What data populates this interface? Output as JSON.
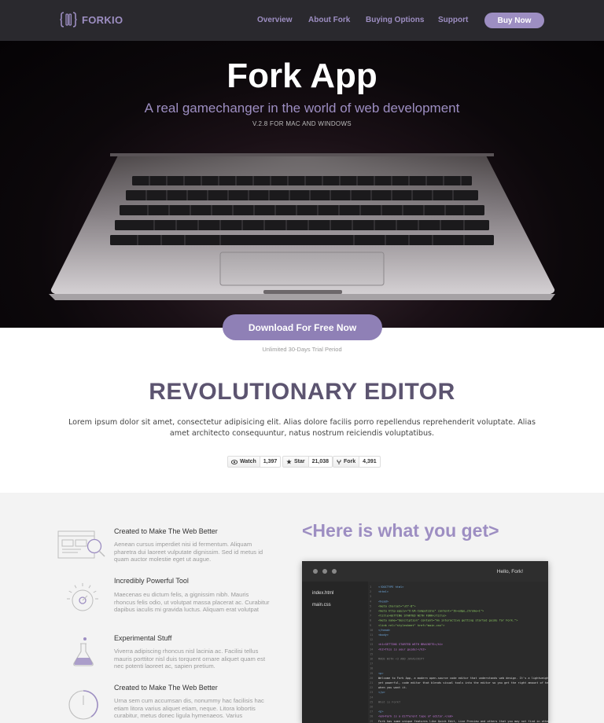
{
  "nav": {
    "logo_text": "FORKIO",
    "links": [
      "Overview",
      "About Fork",
      "Buying Options",
      "Support"
    ],
    "buy_label": "Buy Now"
  },
  "hero": {
    "title": "Fork App",
    "subtitle": "A real gamechanger in the world of web development",
    "version": "V.2.8 FOR MAC AND WINDOWS",
    "download_label": "Download For Free Now",
    "trial_note": "Unlimited 30-Days Trial Period"
  },
  "editor_section": {
    "title": "REVOLUTIONARY EDITOR",
    "text": "Lorem ipsum dolor sit amet, consectetur adipisicing elit. Alias dolore facilis porro repellendus reprehenderit voluptate. Alias amet architecto consequuntur, natus nostrum reiciendis voluptatibus.",
    "github": {
      "watch_label": "Watch",
      "watch_count": "1,397",
      "star_label": "Star",
      "star_count": "21,038",
      "fork_label": "Fork",
      "fork_count": "4,391"
    }
  },
  "features": [
    {
      "icon": "browser-search-icon",
      "title": "Created to Make The Web Better",
      "text": "Aenean cursus imperdiet nisi id fermentum. Aliquam pharetra dui laoreet vulputate dignissim. Sed id metus id quam auctor molestie eget ut augue."
    },
    {
      "icon": "dial-icon",
      "title": "Incredibly Powerful Tool",
      "text": "Maecenas eu dictum felis, a gignissim nibh. Mauris rhoncus felis odio, ut volutpat massa placerat ac. Curabitur dapibus iaculis mi gravida luctus. Aliquam erat volutpat"
    },
    {
      "icon": "flask-icon",
      "title": "Experimental Stuff",
      "text": "Viverra adipiscing rhoncus nisl lacinia ac. Facilisi tellus mauris porttitor nisl duis torquent ornare aliquet quam est nec potenti laoreet ac, sapien pretium."
    },
    {
      "icon": "clock-icon",
      "title": "Created to Make The Web Better",
      "text": "Urna sem cum accumsan dis, nonummy hac facilisis hac etiam litora varius aliquet etiam, neque. Litora lobortis curabitur, metus donec ligula hymenaeos. Varius"
    }
  ],
  "get_section": {
    "title": "<Here is what you get>",
    "window_title": "Hello, Fork!",
    "files": [
      "index.html",
      "main.css"
    ],
    "code_lines": [
      "<!DOCTYPE html>",
      "<html>",
      "",
      "  <head>",
      "    <meta charset=\"utf-8\">",
      "    <meta http-equiv=\"X-UA-Compatible\" content=\"IE=edge,chrome=1\">",
      "    <title>GETTING STARTED WITH FORK</title>",
      "    <meta name=\"description\" content=\"An interactive getting started guide for Fork.\">",
      "    <link rel=\"stylesheet\" href=\"main.css\">",
      "  </head>",
      "  <body>",
      "",
      "    <h1>GETTING STARTED WITH BRACKETS</h1>",
      "    <h2>This is your guide!</h2>",
      "",
      "      MADE WITH <3 AND JAVASCRIPT",
      "",
      "",
      "    <p>",
      "      Welcome to Fork App, a modern open-source code editor that understands web design. It's a lightweight,",
      "      yet powerful, code editor that blends visual tools into the editor so you get the right amount of help",
      "      when you want it.",
      "    </p>",
      "",
      "      What is Fork?",
      "",
      "    <p>",
      "      <em>Fork is a different type of editor.</em>",
      "      Fork has some unique features like Quick Edit, Live Preview and others that you may not find in other"
    ]
  }
}
